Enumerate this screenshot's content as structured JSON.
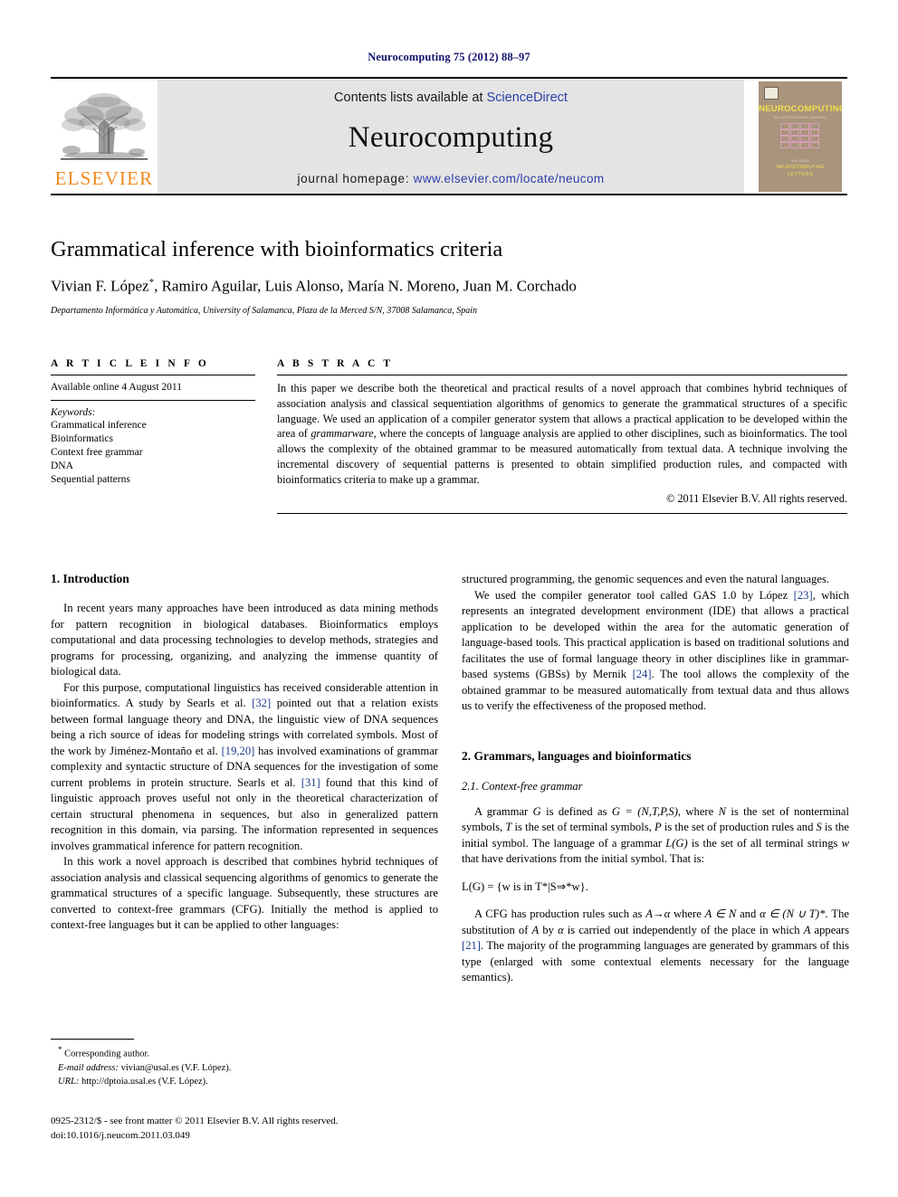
{
  "running_head": "Neurocomputing 75 (2012) 88–97",
  "masthead": {
    "contents_prefix": "Contents lists available at ",
    "sciencedirect": "ScienceDirect",
    "journal_name": "Neurocomputing",
    "homepage_label": "journal homepage: ",
    "homepage_url": "www.elsevier.com/locate/neucom",
    "publisher_wordmark": "ELSEVIER",
    "accent_orange": "#f08a1d",
    "link_blue": "#2b3faa",
    "band_gray": "#e4e4e4"
  },
  "cover": {
    "title": "NEUROCOMPUTING",
    "subtitle": "AN INTERNATIONAL JOURNAL",
    "footer_small": "INCLUDING",
    "footer_line1": "NEUROCOMPUTING",
    "footer_line2": "LETTERS",
    "background": "#a9947c",
    "title_color": "#f2e04a"
  },
  "title_block": {
    "title": "Grammatical inference with bioinformatics criteria",
    "authors": "Vivian F. López",
    "authors_rest": ", Ramiro Aguilar, Luis Alonso, María N. Moreno, Juan M. Corchado",
    "corresponding_marker": "*",
    "affiliation": "Departamento Informática y Automática, University of Salamanca, Plaza de la Merced S/N, 37008 Salamanca, Spain"
  },
  "article_info": {
    "heading": "A R T I C L E  I N F O",
    "history": "Available online 4 August 2011",
    "keywords_label": "Keywords:",
    "keywords": [
      "Grammatical inference",
      "Bioinformatics",
      "Context free grammar",
      "DNA",
      "Sequential patterns"
    ]
  },
  "abstract": {
    "heading": "A B S T R A C T",
    "p1_a": "In this paper we describe both the theoretical and practical results of a novel approach that combines hybrid techniques of association analysis and classical sequentiation algorithms of genomics to generate the grammatical structures of a specific language. We used an application of a compiler generator system that allows a practical application to be developed within the area of ",
    "p1_em1": "grammarware",
    "p1_b": ", where the concepts of language analysis are applied to other disciplines, such as bioinformatics. The tool allows the complexity of the obtained grammar to be measured automatically from textual data. A technique involving the incremental discovery of sequential patterns is presented to obtain simplified production rules, and compacted with bioinformatics criteria to make up a grammar.",
    "copyright": "© 2011 Elsevier B.V. All rights reserved."
  },
  "sections": {
    "intro_heading": "1.  Introduction",
    "intro_p1": "In recent years many approaches have been introduced as data mining methods for pattern recognition in biological databases. Bioinformatics employs computational and data processing technologies to develop methods, strategies and programs for processing, organizing, and analyzing the immense quantity of biological data.",
    "intro_p2_a": "For this purpose, computational linguistics has received considerable attention in bioinformatics. A study by Searls et al. ",
    "intro_p2_ref1": "[32]",
    "intro_p2_b": " pointed out that a relation exists between formal language theory and DNA, the linguistic view of DNA sequences being a rich source of ideas for modeling strings with correlated symbols. Most of the work by Jiménez-Montaño et al. ",
    "intro_p2_ref2": "[19,20]",
    "intro_p2_c": " has involved examinations of grammar complexity and syntactic structure of DNA sequences for the investigation of some current problems in protein structure. Searls et al. ",
    "intro_p2_ref3": "[31]",
    "intro_p2_d": " found that this kind of linguistic approach proves useful not only in the theoretical characterization of certain structural phenomena in sequences, but also in generalized pattern recognition in this domain, via parsing. The information represented in sequences involves grammatical inference for pattern recognition.",
    "intro_p3": "In this work a novel approach is described that combines hybrid techniques of association analysis and classical sequencing algorithms of genomics to generate the grammatical structures of a specific language. Subsequently, these structures are converted to context-free grammars (CFG). Initially the method is applied to context-free languages but it can be applied to other languages:",
    "intro_p4": "structured programming, the genomic sequences and even the natural languages.",
    "intro_p5_a": "We used the compiler generator tool called GAS 1.0 by López ",
    "intro_p5_ref1": "[23]",
    "intro_p5_b": ", which represents an integrated development environment (IDE) that allows a practical application to be developed within the area for the automatic generation of language-based tools. This practical application is based on traditional solutions and facilitates the use of formal language theory in other disciplines like in grammar-based systems (GBSs) by Mernik ",
    "intro_p5_ref2": "[24]",
    "intro_p5_c": ". The tool allows the complexity of the obtained grammar to be measured automatically from textual data and thus allows us to verify the effectiveness of the proposed method.",
    "sec2_heading": "2.  Grammars, languages and bioinformatics",
    "sec21_heading": "2.1.  Context-free grammar",
    "sec21_p1_a": "A grammar ",
    "sec21_p1_g": "G",
    "sec21_p1_b": " is defined as ",
    "sec21_p1_def": "G = (N,T,P,S)",
    "sec21_p1_c": ", where ",
    "sec21_p1_N": "N",
    "sec21_p1_d": " is the set of nonterminal symbols, ",
    "sec21_p1_T": "T",
    "sec21_p1_e": " is the set of terminal symbols, ",
    "sec21_p1_P": "P",
    "sec21_p1_f": " is the set of production rules and ",
    "sec21_p1_S": "S",
    "sec21_p1_g2": " is the initial symbol. The language of a grammar ",
    "sec21_p1_LG": "L(G)",
    "sec21_p1_h": " is the set of all terminal strings ",
    "sec21_p1_w": "w",
    "sec21_p1_i": " that have derivations from the initial symbol. That is:",
    "sec21_eq": "L(G) = {w is in T*|S⇒*w}.",
    "sec21_p2_a": "A CFG has production rules such as ",
    "sec21_p2_rule": "A→α",
    "sec21_p2_b": " where ",
    "sec21_p2_An": "A ∈ N",
    "sec21_p2_c": " and ",
    "sec21_p2_alpha": "α ∈ (N ∪ T)*",
    "sec21_p2_d": ". The substitution of ",
    "sec21_p2_A2": "A",
    "sec21_p2_e": " by ",
    "sec21_p2_a2": "α",
    "sec21_p2_f": " is carried out independently of the place in which ",
    "sec21_p2_A3": "A",
    "sec21_p2_g": " appears ",
    "sec21_p2_ref": "[21]",
    "sec21_p2_h": ". The majority of the programming languages are generated by grammars of this type (enlarged with some contextual elements necessary for the language semantics)."
  },
  "footnote": {
    "corresponding": "Corresponding author.",
    "email_label": "E-mail address:",
    "email_value": " vivian@usal.es (V.F. López).",
    "url_label": "URL:",
    "url_value": " http://dptoia.usal.es (V.F. López)."
  },
  "imprint": {
    "line1": "0925-2312/$ - see front matter © 2011 Elsevier B.V. All rights reserved.",
    "line2": "doi:10.1016/j.neucom.2011.03.049"
  }
}
